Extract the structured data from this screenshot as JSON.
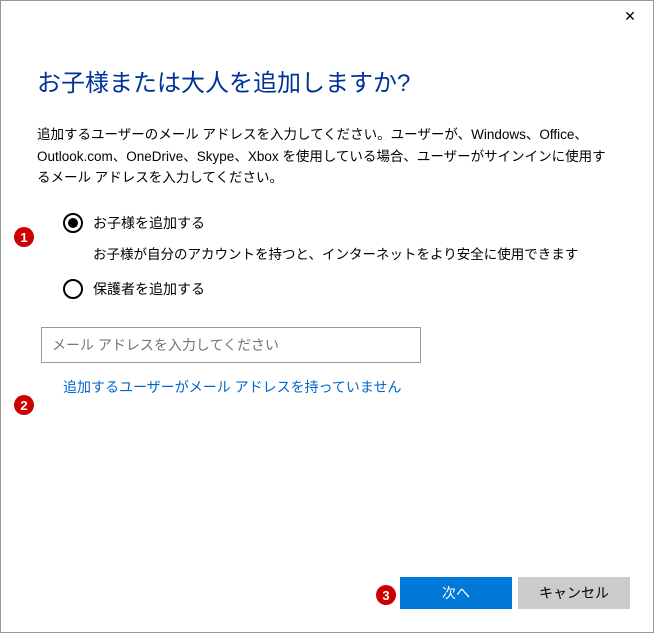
{
  "title": "お子様または大人を追加しますか?",
  "description": "追加するユーザーのメール アドレスを入力してください。ユーザーが、Windows、Office、Outlook.com、OneDrive、Skype、Xbox を使用している場合、ユーザーがサインインに使用するメール アドレスを入力してください。",
  "radio": {
    "child": {
      "label": "お子様を追加する",
      "help": "お子様が自分のアカウントを持つと、インターネットをより安全に使用できます",
      "checked": true
    },
    "guardian": {
      "label": "保護者を追加する",
      "checked": false
    }
  },
  "email": {
    "placeholder": "メール アドレスを入力してください"
  },
  "link_no_email": "追加するユーザーがメール アドレスを持っていません",
  "buttons": {
    "next": "次へ",
    "cancel": "キャンセル"
  },
  "annotations": {
    "1": "1",
    "2": "2",
    "3": "3"
  }
}
